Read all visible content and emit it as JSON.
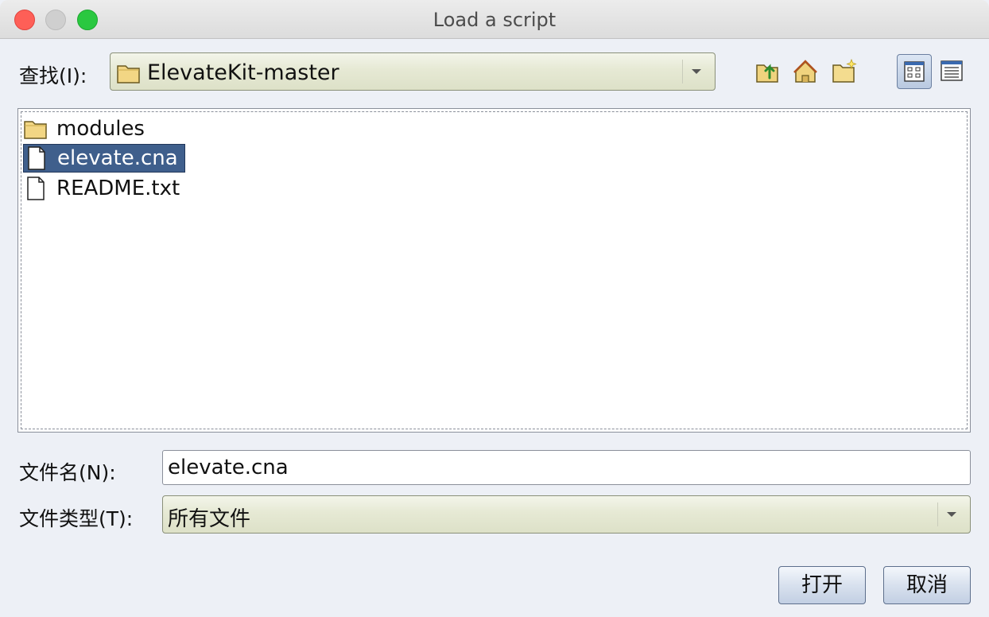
{
  "window": {
    "title": "Load a script"
  },
  "lookin": {
    "label": "查找(I):",
    "value": "ElevateKit-master"
  },
  "toolbar": {
    "icons": [
      "up-folder-icon",
      "home-icon",
      "new-folder-icon",
      "list-view-icon",
      "details-view-icon"
    ]
  },
  "files": [
    {
      "name": "modules",
      "type": "folder",
      "selected": false
    },
    {
      "name": "elevate.cna",
      "type": "file",
      "selected": true
    },
    {
      "name": "README.txt",
      "type": "file",
      "selected": false
    }
  ],
  "filename": {
    "label": "文件名(N):",
    "value": "elevate.cna"
  },
  "filetype": {
    "label": "文件类型(T):",
    "value": "所有文件"
  },
  "buttons": {
    "open": "打开",
    "cancel": "取消"
  },
  "colors": {
    "selection": "#3f5f8c",
    "combo_bg": "#e6e9d4",
    "button_bg": "#d8e1ee"
  }
}
